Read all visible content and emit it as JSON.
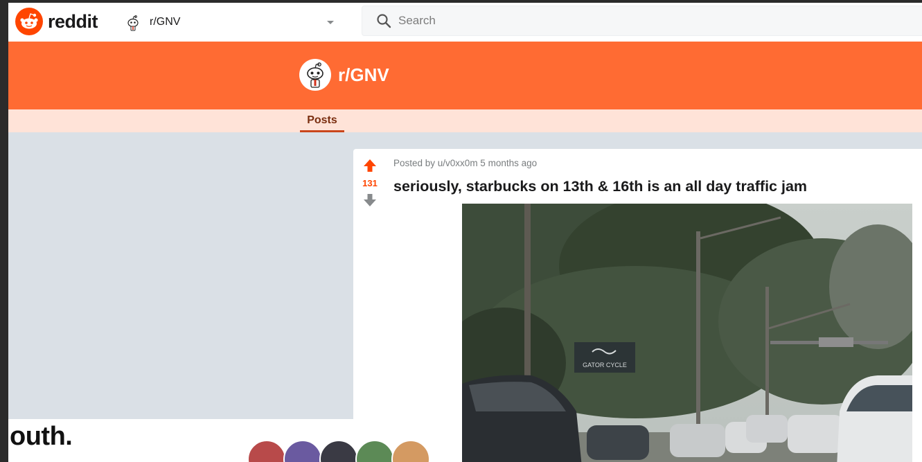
{
  "header": {
    "logo_text": "reddit",
    "community": "r/GNV",
    "search_placeholder": "Search"
  },
  "banner": {
    "title": "r/GNV"
  },
  "tabs": [
    {
      "label": "Posts",
      "active": true
    }
  ],
  "post": {
    "score": "131",
    "meta": "Posted by u/v0xx0m 5 months ago",
    "title": "seriously, starbucks on 13th & 16th is an all day traffic jam",
    "image_sign_text": "GATOR CYCLE"
  },
  "overlay": {
    "text": "outh."
  },
  "colors": {
    "brand": "#ff4500",
    "banner": "#ff6b33",
    "tabbar": "#ffe3d8",
    "background": "#dae0e6"
  },
  "icons": [
    "reddit-logo-icon",
    "snoo-icon",
    "chevron-down-icon",
    "search-icon",
    "upvote-icon",
    "downvote-icon"
  ]
}
